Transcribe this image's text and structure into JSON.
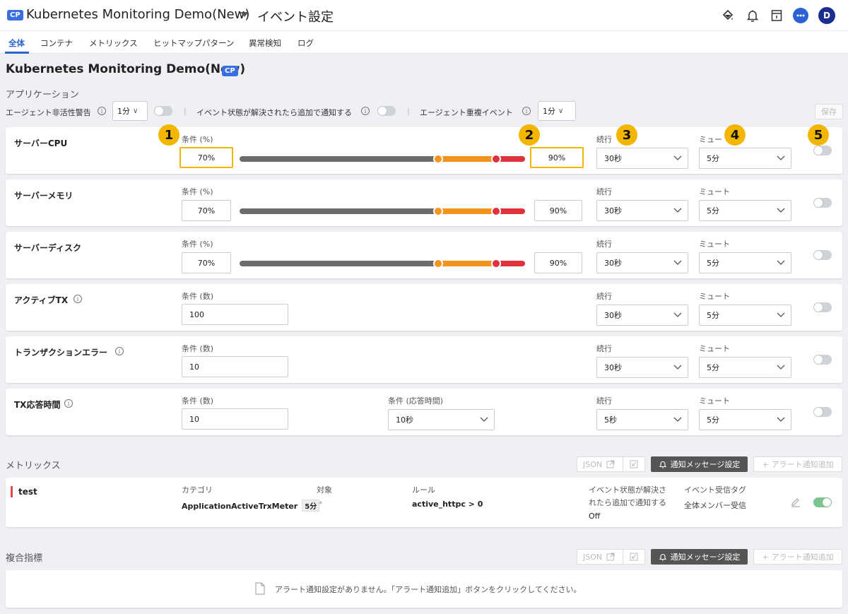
{
  "header": {
    "badge": "CP",
    "app_title": "Kubernetes Monitoring Demo(New)",
    "page_title": "イベント設定",
    "avatar_initial": "D",
    "accent": "#2a62d6"
  },
  "tabs": [
    {
      "label": "全体",
      "active": true
    },
    {
      "label": "コンテナ"
    },
    {
      "label": "メトリックス"
    },
    {
      "label": "ヒットマップパターン"
    },
    {
      "label": "異常検知"
    },
    {
      "label": "ログ"
    }
  ],
  "project": {
    "title": "Kubernetes Monitoring Demo(New)",
    "badge": "CP"
  },
  "application": {
    "section_label": "アプリケーション",
    "agent_inactive_label": "エージェント非活性警告",
    "agent_inactive_value": "1分",
    "resolved_label": "イベント状態が解決されたら追加で通知する",
    "dup_label": "エージェント重複イベント",
    "dup_value": "1分",
    "save_label": "保存",
    "separator": "|"
  },
  "rows": [
    {
      "title": "サーバーCPU",
      "cond_label": "条件 (%)",
      "low": "70%",
      "high": "90%",
      "duration_label": "続行",
      "duration": "30秒",
      "mute_label": "ミュート",
      "mute_label_short": "ミュー",
      "mute": "5分"
    },
    {
      "title": "サーバーメモリ",
      "cond_label": "条件 (%)",
      "low": "70%",
      "high": "90%",
      "duration_label": "続行",
      "duration": "30秒",
      "mute_label": "ミュート",
      "mute": "5分"
    },
    {
      "title": "サーバーディスク",
      "cond_label": "条件 (%)",
      "low": "70%",
      "high": "90%",
      "duration_label": "続行",
      "duration": "30秒",
      "mute_label": "ミュート",
      "mute": "5分"
    },
    {
      "title": "アクティブTX",
      "cond_label": "条件 (数)",
      "value": "100",
      "duration_label": "続行",
      "duration": "30秒",
      "mute_label": "ミュート",
      "mute": "5分"
    },
    {
      "title": "トランザクションエラー",
      "cond_label": "条件 (数)",
      "value": "10",
      "duration_label": "続行",
      "duration": "30秒",
      "mute_label": "ミュート",
      "mute": "5分"
    },
    {
      "title": "TX応答時間",
      "cond_label": "条件 (数)",
      "value": "10",
      "resp_label": "条件 (応答時間)",
      "resp_value": "10秒",
      "duration_label": "続行",
      "duration": "5秒",
      "mute_label": "ミュート",
      "mute": "5分"
    }
  ],
  "callouts": [
    "1",
    "2",
    "3",
    "4",
    "5"
  ],
  "metrics": {
    "section_label": "メトリックス",
    "json_label": "JSON",
    "notify_msg_label": "通知メッセージ設定",
    "add_alert_label": "アラート通知追加",
    "item": {
      "name": "test",
      "category_label": "カテゴリ",
      "category_value": "ApplicationActiveTrxMeter",
      "category_tag": "5分",
      "target_label": "対象",
      "target_value": "*",
      "rule_label": "ルール",
      "rule_value": "active_httpc > 0",
      "resolved_label_1": "イベント状態が解決さ",
      "resolved_label_2": "れたら追加で通知する",
      "resolved_value": "Off",
      "tag_label": "イベント受信タグ",
      "tag_value": "全体メンバー受信"
    }
  },
  "composite": {
    "section_label": "複合指標",
    "json_label": "JSON",
    "notify_msg_label": "通知メッセージ設定",
    "add_alert_label": "アラート通知追加",
    "empty_text": "アラート通知設定がありません。「アラート通知追加」ボタンをクリックしてください。"
  },
  "colors": {
    "slider_gray": "#6b6b6b",
    "slider_orange": "#f5931e",
    "slider_red": "#e0323a",
    "highlight": "#f2b600",
    "toggle_on": "#7dc58e"
  }
}
